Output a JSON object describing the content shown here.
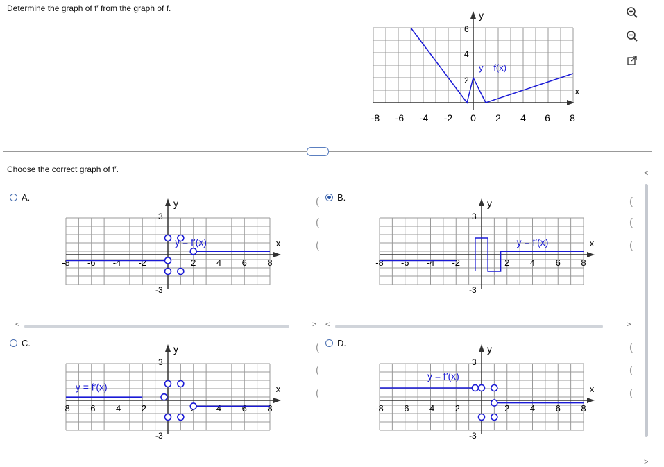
{
  "question": "Determine the graph of f′ from the graph of f.",
  "subquestion": "Choose the correct graph of f′.",
  "more_button": "···",
  "colors": {
    "curve": "#1a1ad6",
    "grid": "#999999",
    "accent": "#2a56a8"
  },
  "main_graph": {
    "ylabel": "y",
    "xlabel": "x",
    "curve_label": "y = f(x)",
    "x_ticks": [
      "-8",
      "-6",
      "-4",
      "-2",
      "0",
      "2",
      "4",
      "6",
      "8"
    ],
    "y_ticks": [
      "6",
      "4",
      "2"
    ]
  },
  "options": [
    {
      "letter": "A.",
      "curve_label": "y = f′(x)",
      "ylabel": "y",
      "xlabel": "x",
      "y_top": "3",
      "y_bottom": "-3",
      "x_ticks": [
        "-8",
        "-6",
        "-4",
        "-2",
        "2",
        "4",
        "6",
        "8"
      ],
      "selected": false
    },
    {
      "letter": "B.",
      "curve_label": "y = f′(x)",
      "ylabel": "y",
      "xlabel": "x",
      "y_top": "3",
      "y_bottom": "-3",
      "x_ticks": [
        "-8",
        "-6",
        "-4",
        "-2",
        "2",
        "4",
        "6",
        "8"
      ],
      "selected": true
    },
    {
      "letter": "C.",
      "curve_label": "y = f′(x)",
      "ylabel": "y",
      "xlabel": "x",
      "y_top": "3",
      "y_bottom": "-3",
      "x_ticks": [
        "-8",
        "-6",
        "-4",
        "-2",
        "2",
        "4",
        "6",
        "8"
      ],
      "selected": false
    },
    {
      "letter": "D.",
      "curve_label": "y = f′(x)",
      "ylabel": "y",
      "xlabel": "x",
      "y_top": "3",
      "y_bottom": "-3",
      "x_ticks": [
        "-8",
        "-6",
        "-4",
        "-2",
        "2",
        "4",
        "6",
        "8"
      ],
      "selected": false
    }
  ],
  "tools": [
    "zoom-in-icon",
    "zoom-out-icon",
    "open-new-window-icon"
  ]
}
